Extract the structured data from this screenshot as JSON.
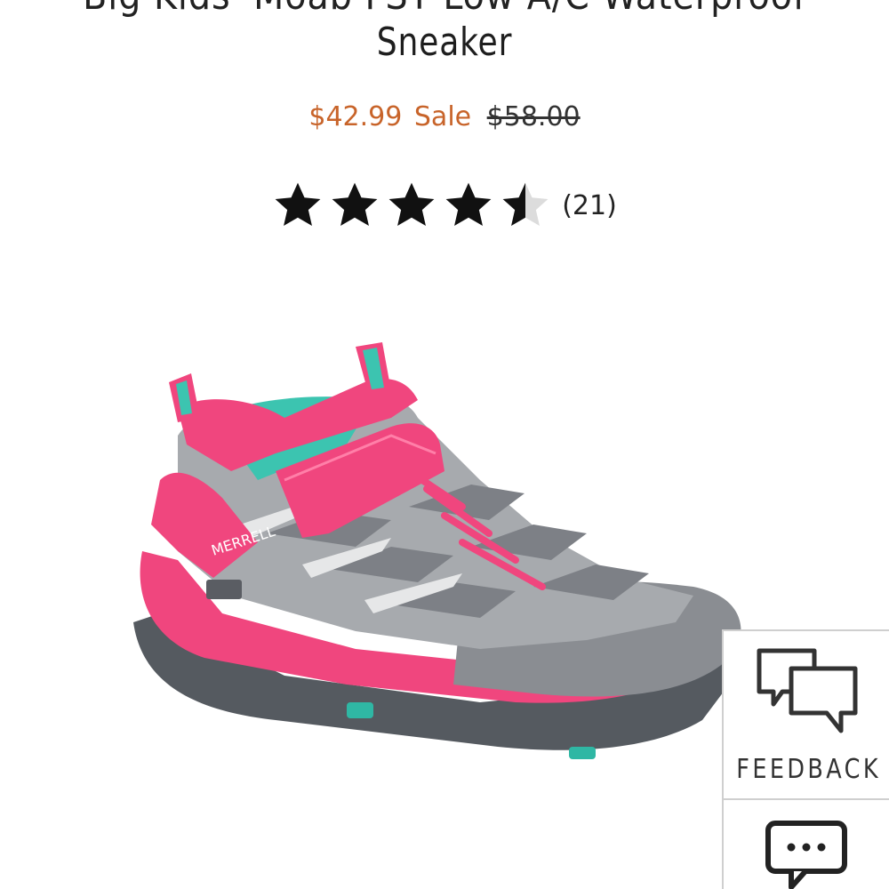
{
  "product": {
    "title_line1_cut": "Big Kids' Moab FST Low A/C Waterproof",
    "title_line2": "Sneaker",
    "sale_price": "$42.99",
    "sale_label": "Sale",
    "original_price": "$58.00",
    "rating_value": 4.5,
    "review_count": "(21)",
    "image_icon": "pink-gray-merrell-sneaker",
    "colors": {
      "sale": "#c8642a",
      "shoe_pink": "#f0467e",
      "shoe_gray": "#8a8d92",
      "shoe_teal": "#3cc4b0"
    }
  },
  "widgets": {
    "feedback_label": "FEEDBACK",
    "feedback_icon": "speech-bubbles-icon",
    "chat_icon": "chat-ellipsis-icon"
  }
}
